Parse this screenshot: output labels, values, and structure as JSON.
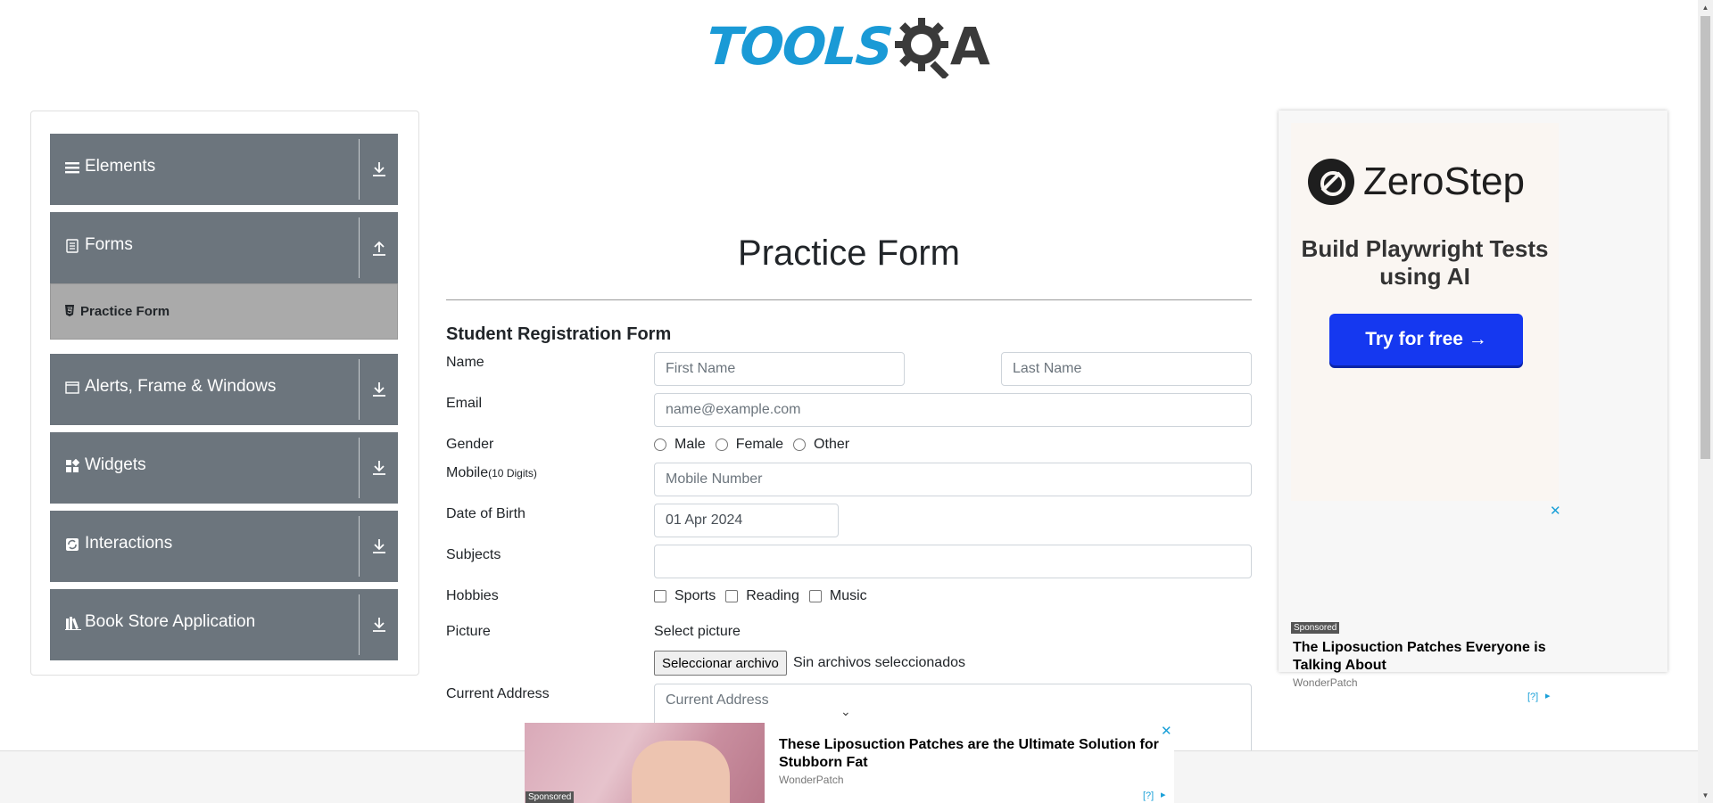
{
  "header": {
    "logo_text_left": "TOOLS",
    "logo_text_right": "A"
  },
  "sidebar": {
    "groups": [
      {
        "label": "Elements",
        "icon": "hamburger-icon",
        "expanded": false
      },
      {
        "label": "Forms",
        "icon": "document-icon",
        "expanded": true
      },
      {
        "label": "Alerts, Frame & Windows",
        "icon": "window-icon",
        "expanded": false
      },
      {
        "label": "Widgets",
        "icon": "widgets-icon",
        "expanded": false
      },
      {
        "label": "Interactions",
        "icon": "interactions-icon",
        "expanded": false
      },
      {
        "label": "Book Store Application",
        "icon": "books-icon",
        "expanded": false
      }
    ],
    "active_item": {
      "label": "Practice Form",
      "icon": "html5-icon"
    }
  },
  "main": {
    "title": "Practice Form",
    "form_heading": "Student Registration Form",
    "labels": {
      "name": "Name",
      "email": "Email",
      "gender": "Gender",
      "mobile": "Mobile",
      "mobile_hint": "(10 Digits)",
      "dob": "Date of Birth",
      "subjects": "Subjects",
      "hobbies": "Hobbies",
      "picture": "Picture",
      "address": "Current Address"
    },
    "placeholders": {
      "first_name": "First Name",
      "last_name": "Last Name",
      "email": "name@example.com",
      "mobile": "Mobile Number",
      "address": "Current Address"
    },
    "dob_value": "01 Apr 2024",
    "genders": [
      "Male",
      "Female",
      "Other"
    ],
    "hobbies": [
      "Sports",
      "Reading",
      "Music"
    ],
    "picture_prompt": "Select picture",
    "file_button": "Seleccionar archivo",
    "file_status": "Sin archivos seleccionados"
  },
  "ad_right": {
    "brand": "ZeroStep",
    "tagline": "Build Playwright Tests using AI",
    "cta": "Try for free →",
    "sponsored_label": "Sponsored",
    "headline": "The Liposuction Patches Everyone is Talking About",
    "source": "WonderPatch",
    "info": "[?]",
    "close": "✕"
  },
  "ad_bottom": {
    "sponsored_label": "Sponsored",
    "headline": "These Liposuction Patches are the Ultimate Solution for Stubborn Fat",
    "source": "WonderPatch",
    "info": "[?]",
    "close": "✕"
  }
}
